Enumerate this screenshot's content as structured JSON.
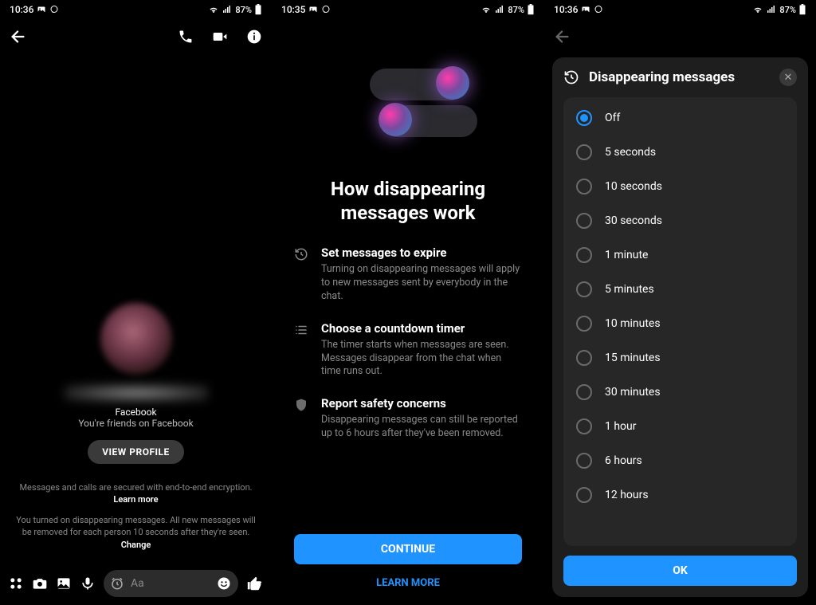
{
  "status": {
    "times": [
      "10:36",
      "10:35",
      "10:36"
    ],
    "battery": "87%"
  },
  "screen1": {
    "sub1": "Facebook",
    "sub2": "You're friends on Facebook",
    "view_profile": "VIEW PROFILE",
    "note1_a": "Messages and calls are secured with end-to-end encryption. ",
    "note1_link": "Learn more",
    "note2_a": "You turned on disappearing messages. All new messages will be removed for each person 10 seconds after they're seen. ",
    "note2_link": "Change",
    "input_placeholder": "Aa"
  },
  "screen2": {
    "title": "How disappearing messages work",
    "items": [
      {
        "h": "Set messages to expire",
        "p": "Turning on disappearing messages will apply to new messages sent by everybody in the chat."
      },
      {
        "h": "Choose a countdown timer",
        "p": "The timer starts when messages are seen. Messages disappear from the chat when time runs out."
      },
      {
        "h": "Report safety concerns",
        "p": "Disappearing messages can still be reported up to 6 hours after they've been removed."
      }
    ],
    "continue": "CONTINUE",
    "learn_more": "LEARN MORE"
  },
  "screen3": {
    "title": "Disappearing messages",
    "options": [
      "Off",
      "5 seconds",
      "10 seconds",
      "30 seconds",
      "1 minute",
      "5 minutes",
      "10 minutes",
      "15 minutes",
      "30 minutes",
      "1 hour",
      "6 hours",
      "12 hours"
    ],
    "selected_index": 0,
    "ok": "OK"
  }
}
